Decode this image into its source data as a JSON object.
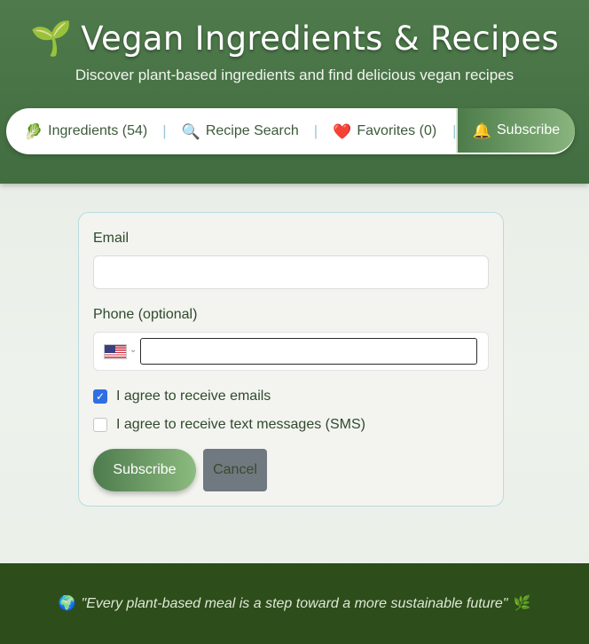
{
  "header": {
    "title_icon": "🌱",
    "title": "Vegan Ingredients & Recipes",
    "subtitle": "Discover plant-based ingredients and find delicious vegan recipes"
  },
  "nav": {
    "items": [
      {
        "icon": "🥬",
        "label": "Ingredients (54)"
      },
      {
        "icon": "🔍",
        "label": "Recipe Search"
      },
      {
        "icon": "❤️",
        "label": "Favorites (0)"
      }
    ],
    "separator": "|",
    "subscribe": {
      "icon": "🔔",
      "label": "Subscribe"
    }
  },
  "form": {
    "email_label": "Email",
    "email_value": "",
    "phone_label": "Phone (optional)",
    "phone_value": "",
    "country": "US",
    "checkbox_emails": {
      "label": "I agree to receive emails",
      "checked": true
    },
    "checkbox_sms": {
      "label": "I agree to receive text messages (SMS)",
      "checked": false
    },
    "submit_label": "Subscribe",
    "cancel_label": "Cancel"
  },
  "footer": {
    "left_icon": "🌍",
    "quote": "\"Every plant-based meal is a step toward a more sustainable future\"",
    "right_icon": "🌿"
  },
  "colors": {
    "header_green": "#4f7a4c",
    "footer_green": "#2d4d1b",
    "checkbox_blue": "#2f6fe4",
    "cancel_gray": "#707880"
  }
}
